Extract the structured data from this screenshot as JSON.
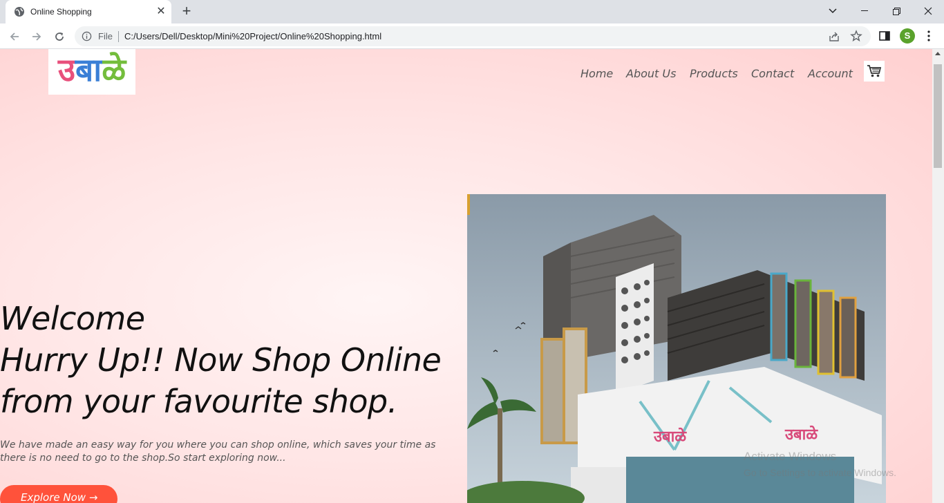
{
  "browser": {
    "tab_title": "Online Shopping",
    "new_tab_symbol": "+",
    "address_scheme_label": "File",
    "url": "C:/Users/Dell/Desktop/Mini%20Project/Online%20Shopping.html",
    "profile_initial": "S"
  },
  "site": {
    "logo_text": "उबाळे",
    "nav": [
      "Home",
      "About Us",
      "Products",
      "Contact",
      "Account"
    ],
    "hero": {
      "line1": "Welcome",
      "line2": "Hurry Up!! Now Shop Online",
      "line3": "from your favourite shop.",
      "paragraph_line1": "We have made an easy way for you where you can shop online, which saves your time as",
      "paragraph_line2": "there is no need to go to the shop.So start exploring now...",
      "button_label": "Explore Now →"
    },
    "store_signs": [
      "उबाळे",
      "उबाळे"
    ]
  },
  "overlay": {
    "watermark_title": "Activate Windows",
    "watermark_sub": "Go to Settings to activate Windows."
  },
  "colors": {
    "accent": "#ff523b",
    "page_bg": "#ffdede",
    "profile": "#5aa22c"
  }
}
